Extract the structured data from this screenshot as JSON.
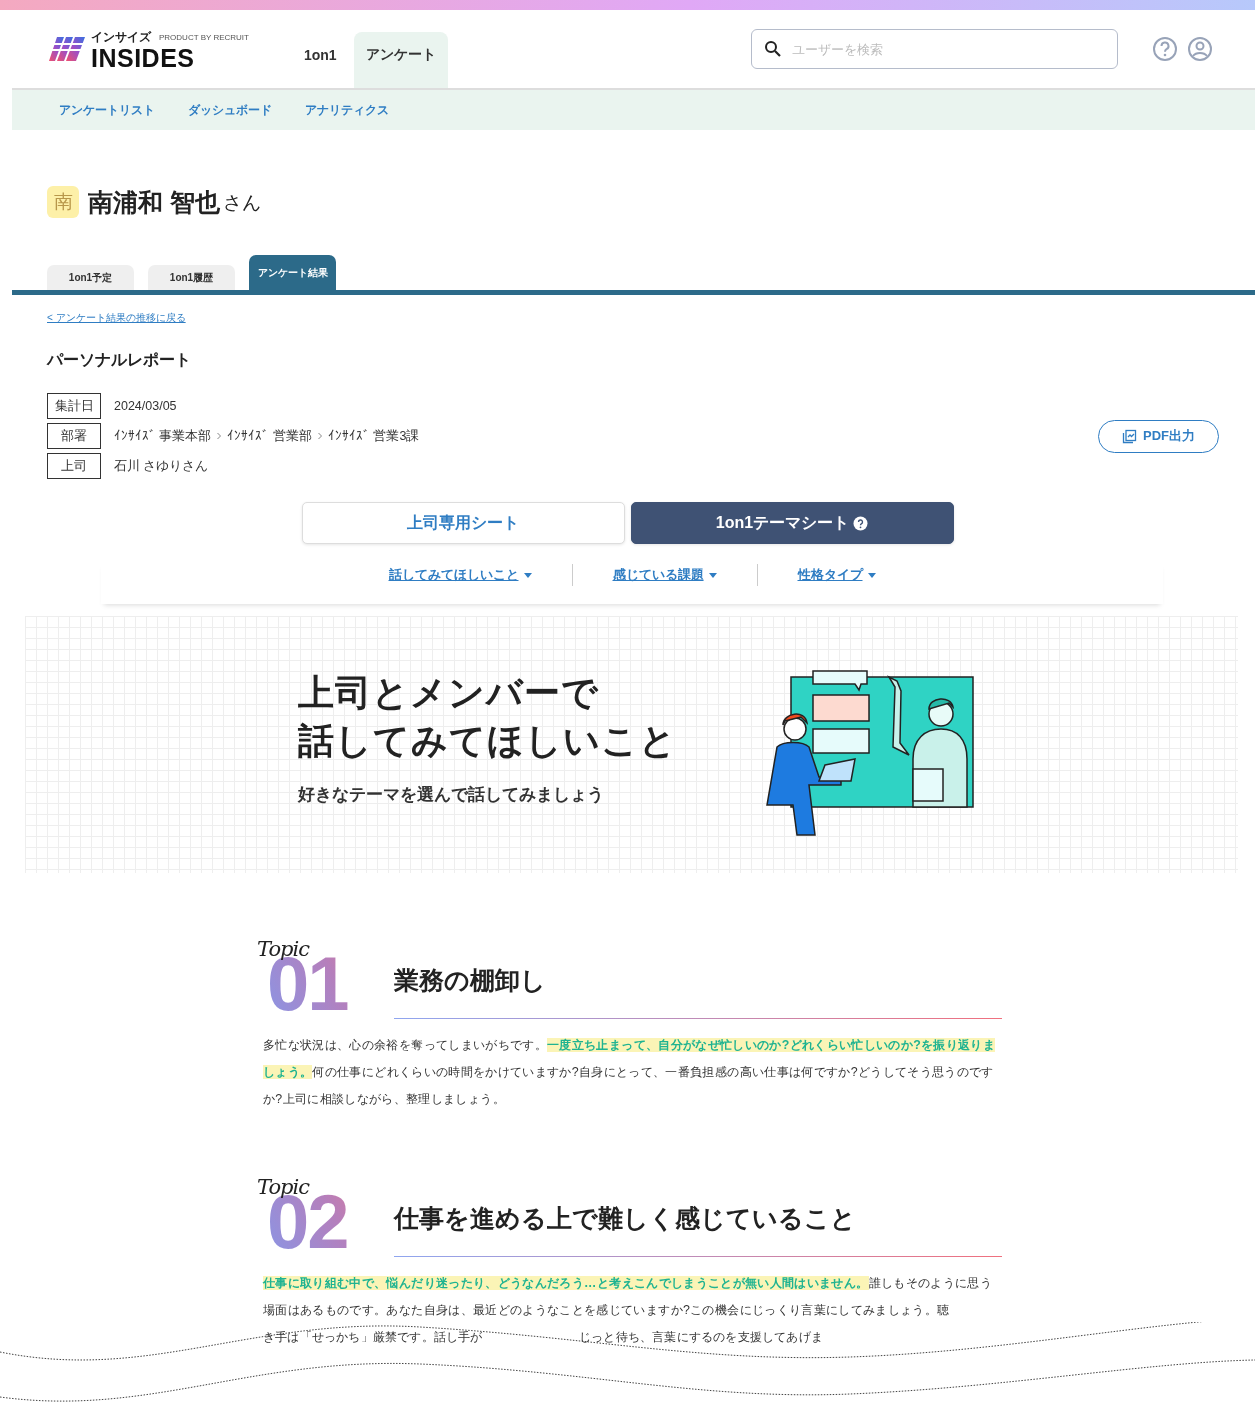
{
  "header": {
    "logo": {
      "kana": "インサイズ",
      "byline": "PRODUCT BY RECRUIT",
      "name": "INSIDES"
    },
    "nav_tabs": [
      {
        "label": "1on1",
        "selected": false
      },
      {
        "label": "アンケート",
        "selected": true
      }
    ],
    "search": {
      "placeholder": "ユーザーを検索"
    }
  },
  "sub_nav": [
    "アンケートリスト",
    "ダッシュボード",
    "アナリティクス"
  ],
  "user": {
    "avatar": "南",
    "name": "南浦和 智也",
    "suffix": "さん"
  },
  "profile_tabs": [
    {
      "label": "1on1予定",
      "selected": false
    },
    {
      "label": "1on1履歴",
      "selected": false
    },
    {
      "label": "アンケート結果",
      "selected": true
    }
  ],
  "back_link": "< アンケート結果の推移に戻る",
  "report": {
    "title": "パーソナルレポート",
    "fields": [
      {
        "label": "集計日",
        "path": [
          "2024/03/05"
        ]
      },
      {
        "label": "部署",
        "path": [
          "ｲﾝｻｲｽﾞ 事業本部",
          "ｲﾝｻｲｽﾞ 営業部",
          "ｲﾝｻｲｽﾞ 営業3課"
        ]
      },
      {
        "label": "上司",
        "path": [
          "石川 さゆりさん"
        ]
      }
    ],
    "pdf_button": "PDF出力"
  },
  "sheet_toggle": [
    {
      "label": "上司専用シート",
      "selected": false,
      "help": false
    },
    {
      "label": "1on1テーマシート",
      "selected": true,
      "help": true
    }
  ],
  "filters": [
    "話してみてほしいこと",
    "感じている課題",
    "性格タイプ"
  ],
  "hero": {
    "title_lines": [
      "上司とメンバーで",
      "話してみてほしいこと"
    ],
    "subtitle": "好きなテーマを選んで話してみましょう"
  },
  "topics": [
    {
      "label": "Topic",
      "number": "01",
      "title": "業務の棚卸し",
      "body": [
        {
          "text": "多忙な状況は、心の余裕を奪ってしまいがちです。",
          "highlight": false
        },
        {
          "text": "一度立ち止まって、自分がなぜ忙しいのか?どれくらい忙しいのか?を振り返りましょう。",
          "highlight": true
        },
        {
          "text": "何の仕事にどれくらいの時間をかけていますか?自身にとって、一番負担感の高い仕事は何ですか?どうしてそう思うのですか?上司に相談しながら、整理しましょう。",
          "highlight": false
        }
      ]
    },
    {
      "label": "Topic",
      "number": "02",
      "title": "仕事を進める上で難しく感じていること",
      "body": [
        {
          "text": "仕事に取り組む中で、悩んだり迷ったり、どうなんだろう…と考えこんでしまうことが無い人間はいません。",
          "highlight": true
        },
        {
          "text": "誰しもそのように思う場面はあるものです。あなた自身は、最近どのようなことを感じていますか?この機会にじっくり言葉にしてみましょう。聴",
          "highlight": false
        }
      ],
      "cut_line": [
        "き手は「せっかち」厳禁です。話し手が",
        "じっと待ち、言葉にするのを支援してあげま"
      ]
    }
  ]
}
